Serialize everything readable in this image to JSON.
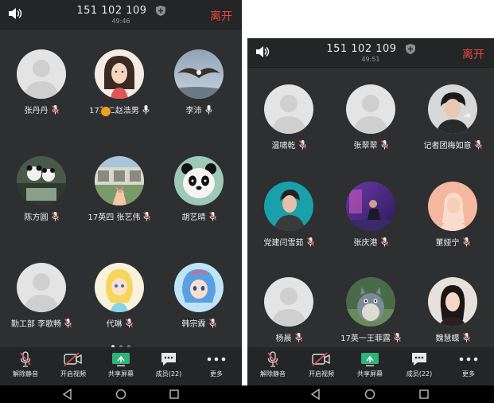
{
  "left": {
    "header": {
      "meeting_number": "151 102 109",
      "elapsed": "49:46",
      "leave_label": "离开"
    },
    "participants": [
      {
        "name": "张丹丹",
        "avatar": "default",
        "mic": "muted"
      },
      {
        "name": "17英二赵浩男",
        "avatar": "cartoon-woman",
        "mic": "active"
      },
      {
        "name": "李沛",
        "avatar": "eagle",
        "mic": "active"
      },
      {
        "name": "陈方圆",
        "avatar": "panda-photo",
        "mic": "muted"
      },
      {
        "name": "17英四 张艺伟",
        "avatar": "hand-photo",
        "mic": "muted"
      },
      {
        "name": "胡艺晴",
        "avatar": "panda-face",
        "mic": "muted"
      },
      {
        "name": "勤工部 李歌畅",
        "avatar": "default",
        "mic": "muted"
      },
      {
        "name": "代琳",
        "avatar": "cartoon-girl-blonde",
        "mic": "muted"
      },
      {
        "name": "韩宗霖",
        "avatar": "cartoon-girl-blue",
        "mic": "muted"
      }
    ],
    "page_indicator": {
      "pages": 3,
      "current": 1
    }
  },
  "right": {
    "header": {
      "meeting_number": "151 102 109",
      "elapsed": "49:51",
      "leave_label": "离开"
    },
    "participants": [
      {
        "name": "温啸乾",
        "avatar": "default",
        "mic": "muted"
      },
      {
        "name": "张翠翠",
        "avatar": "default",
        "mic": "muted"
      },
      {
        "name": "记者团梅如意",
        "avatar": "man-photo",
        "mic": "muted"
      },
      {
        "name": "党建闫雪茹",
        "avatar": "man-teal",
        "mic": "muted"
      },
      {
        "name": "张庆港",
        "avatar": "purple-scene",
        "mic": "muted"
      },
      {
        "name": "董娅宁",
        "avatar": "peach-woman",
        "mic": "muted"
      },
      {
        "name": "杨晨",
        "avatar": "default",
        "mic": "muted"
      },
      {
        "name": "17英一王菲露",
        "avatar": "totoro",
        "mic": "muted"
      },
      {
        "name": "魏慧蝶",
        "avatar": "woman-photo",
        "mic": "muted"
      }
    ],
    "page_indicator": {
      "pages": 3,
      "current": 2
    }
  },
  "toolbar": {
    "unmute_label": "解除静音",
    "video_label": "开启视频",
    "share_label": "共享屏幕",
    "members_label": "成员(22)",
    "more_label": "更多"
  },
  "colors": {
    "leave": "#f04438",
    "mic_muted": "#e25555",
    "share_icon": "#2fb37a",
    "badge": "#f0a020"
  }
}
